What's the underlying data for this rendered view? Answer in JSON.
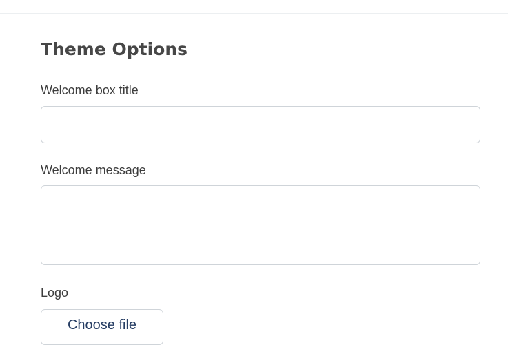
{
  "section": {
    "heading": "Theme Options"
  },
  "fields": {
    "welcome_title": {
      "label": "Welcome box title",
      "value": "",
      "placeholder": ""
    },
    "welcome_message": {
      "label": "Welcome message",
      "value": "",
      "placeholder": ""
    },
    "logo": {
      "label": "Logo",
      "button_label": "Choose file"
    }
  },
  "colors": {
    "heading": "#474747",
    "label": "#3d3d3d",
    "input_border": "#cfd4d9",
    "button_text": "#263d63",
    "divider": "#eceff1"
  }
}
